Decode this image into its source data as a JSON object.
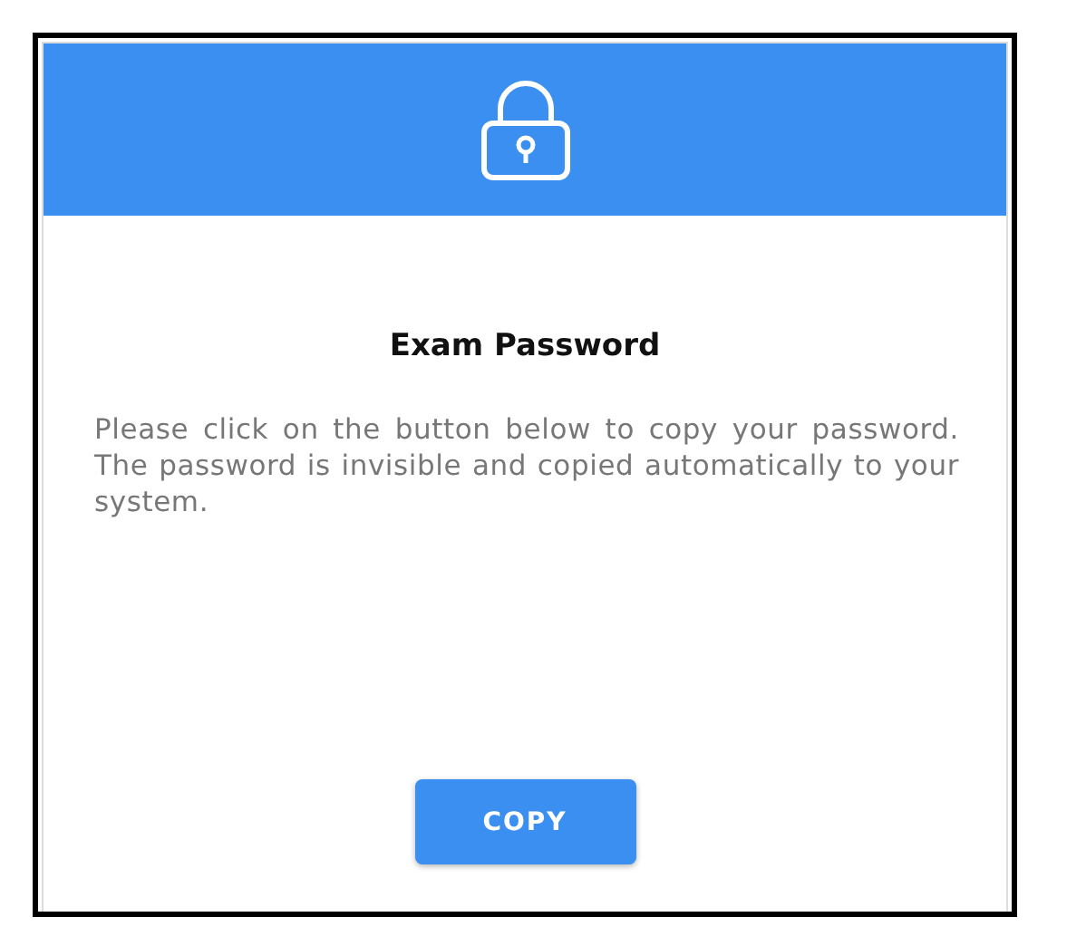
{
  "dialog": {
    "title": "Exam Password",
    "message": "Please click on the button below to copy your password. The password is invisible and copied automatically to your system.",
    "button": "COPY"
  }
}
